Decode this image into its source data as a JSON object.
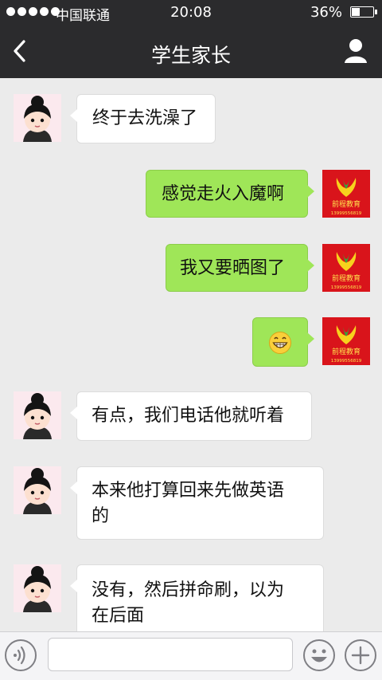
{
  "status": {
    "carrier": "中国联通",
    "time": "20:08",
    "battery": "36%"
  },
  "header": {
    "title": "学生家长"
  },
  "org_avatar": {
    "line1": "前程教育",
    "line2": "13999556819"
  },
  "messages": [
    {
      "side": "left",
      "sender": "contact",
      "text": "终于去洗澡了"
    },
    {
      "side": "right",
      "sender": "me",
      "text": "感觉走火入魔啊"
    },
    {
      "side": "right",
      "sender": "me",
      "text": "我又要晒图了"
    },
    {
      "side": "right",
      "sender": "me",
      "emoji": "grinning-face-emoji"
    },
    {
      "side": "left",
      "sender": "contact",
      "text": "有点，我们电话他就听着"
    },
    {
      "side": "left",
      "sender": "contact",
      "lines": [
        "本来他打算回来先做英语",
        "的"
      ]
    },
    {
      "side": "left",
      "sender": "contact",
      "lines": [
        "没有，然后拼命刷，以为",
        "在后面"
      ]
    }
  ],
  "input": {
    "value": "",
    "placeholder": ""
  },
  "icons": {
    "back": "chevron-left-icon",
    "profile": "person-icon",
    "voice": "voice-icon",
    "emoji": "smiley-icon",
    "plus": "plus-icon"
  },
  "colors": {
    "bar": "#2b2b2d",
    "chat_bg": "#ebebeb",
    "my_bubble": "#9fe658",
    "their_bubble": "#ffffff",
    "org_red": "#d9141b"
  }
}
